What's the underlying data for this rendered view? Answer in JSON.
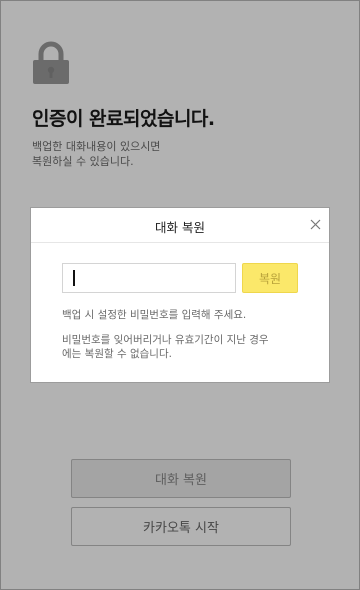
{
  "background": {
    "icon": "lock-icon",
    "headline": "인증이 완료되었습니다.",
    "subtext": [
      "백업한 대화내용이 있으시면",
      "복원하실 수 있습니다."
    ],
    "restore_button": "대화 복원",
    "start_button": "카카오톡 시작"
  },
  "dialog": {
    "title": "대화 복원",
    "close_icon": "close-icon",
    "password_value": "",
    "restore_button": "복원",
    "hint": "백업 시 설정한 비밀번호를 입력해 주세요.",
    "warning": [
      "비밀번호를 잊어버리거나 유효기간이 지난 경우",
      "에는 복원할 수 없습니다."
    ]
  },
  "colors": {
    "accent_yellow": "#fbe86a",
    "overlay": "#000000"
  }
}
